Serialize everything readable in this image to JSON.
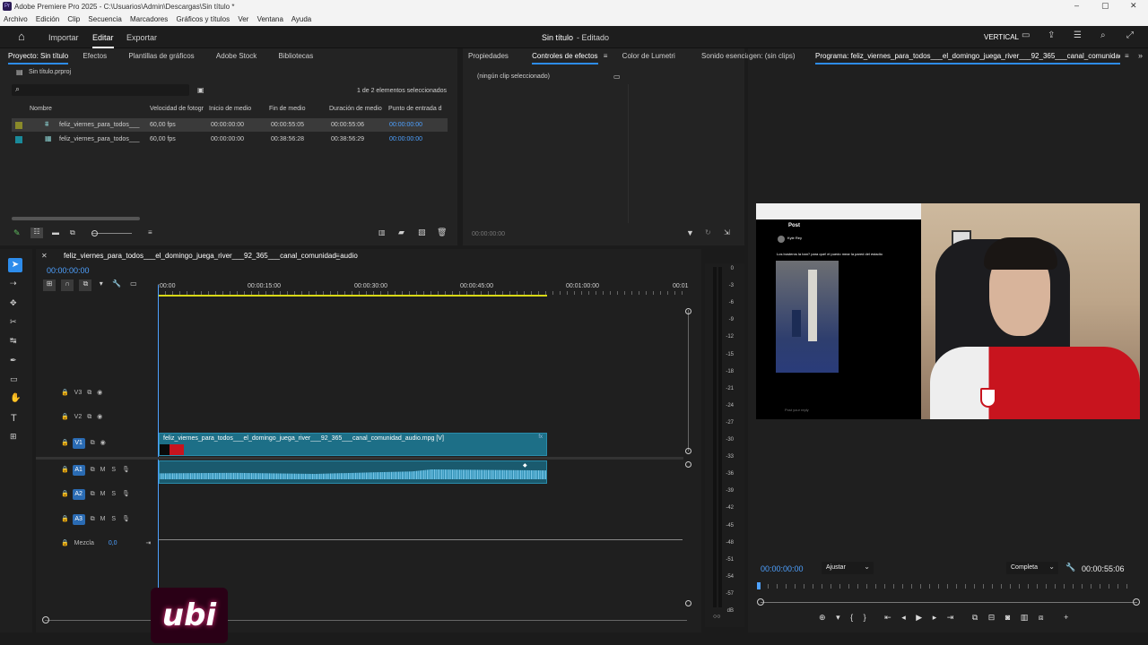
{
  "window": {
    "title": "Adobe Premiere Pro 2025 - C:\\Usuarios\\Admin\\Descargas\\Sin título *",
    "controls": [
      "–",
      "▢",
      "✕"
    ]
  },
  "menu": [
    "Archivo",
    "Edición",
    "Clip",
    "Secuencia",
    "Marcadores",
    "Gráficos y títulos",
    "Ver",
    "Ventana",
    "Ayuda"
  ],
  "appbar": {
    "tabs": [
      "Importar",
      "Editar",
      "Exportar"
    ],
    "active_tab": "Editar",
    "doc_title": "Sin título",
    "doc_status": "- Editado",
    "vertical": "VERTICAL"
  },
  "project_panel": {
    "tabs": [
      "Proyecto: Sin título",
      "Efectos",
      "Plantillas de gráficos",
      "Adobe Stock",
      "Bibliotecas"
    ],
    "file": "Sin título.prproj",
    "selection_count": "1 de 2 elementos seleccionados",
    "columns": [
      "Nombre",
      "Velocidad de fotogr",
      "Inicio de medio",
      "Fin de medio",
      "Duración de medio",
      "Punto de entrada d"
    ],
    "rows": [
      {
        "label_color": "#8a8a2a",
        "name": "feliz_viernes_para_todos___",
        "fps": "60,00 fps",
        "start": "00:00:00:00",
        "end": "00:00:55:05",
        "dur": "00:00:55:06",
        "in": "00:00:00:00"
      },
      {
        "label_color": "#1a8a9a",
        "name": "feliz_viernes_para_todos___",
        "fps": "60,00 fps",
        "start": "00:00:00:00",
        "end": "00:38:56:28",
        "dur": "00:38:56:29",
        "in": "00:00:00:00"
      }
    ]
  },
  "effects_panel": {
    "tabs": [
      "Propiedades",
      "Controles de efectos",
      "Color de Lumetri",
      "Sonido esencial"
    ],
    "empty": "(ningún clip seleccionado)",
    "timecode": "00:00:00:00"
  },
  "program_panel": {
    "source_tab": "gen: (sin clips)",
    "program_tab": "Programa: feliz_viernes_para_todos___el_domingo_juega_river___92_365___canal_comunidad_audio",
    "timecode": "00:00:00:00",
    "fit": "Ajustar",
    "quality": "Completa",
    "duration": "00:00:55:06"
  },
  "frame": {
    "post_header": "Post",
    "user": "Kyle Rey  ",
    "post_text": "Los bosteros la ban? para que! el puedo mear la pared del estadio",
    "reply": "Post your reply"
  },
  "timeline": {
    "sequence_tab": "feliz_viernes_para_todos___el_domingo_juega_river___92_365___canal_comunidad_audio",
    "timecode": "00:00:00:00",
    "ruler": [
      ":00:00",
      "00:00:15:00",
      "00:00:30:00",
      "00:00:45:00",
      "00:01:00:00",
      "00:01"
    ],
    "tracks": {
      "video": [
        "V3",
        "V2",
        "V1"
      ],
      "audio": [
        "A1",
        "A2",
        "A3"
      ]
    },
    "mix_label": "Mezcla",
    "mix_value": "0,0",
    "clip_name": "feliz_viernes_para_todos___el_domingo_juega_river___92_365___canal_comunidad_audio.mpg [V]"
  },
  "meter": [
    "0",
    "-3",
    "-6",
    "-9",
    "-12",
    "-15",
    "-18",
    "-21",
    "-24",
    "-27",
    "-30",
    "-33",
    "-36",
    "-39",
    "-42",
    "-45",
    "-48",
    "-51",
    "-54",
    "-57",
    "dB"
  ],
  "watermark": "ubi"
}
